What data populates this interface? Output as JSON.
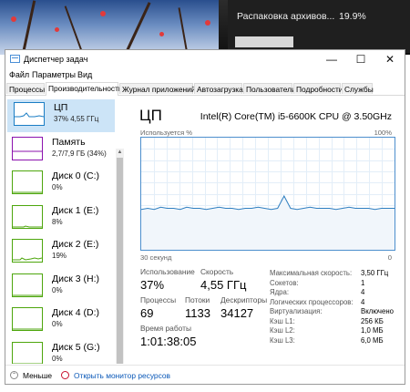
{
  "toast": {
    "title": "Распаковка архивов...",
    "percent": "19.9%"
  },
  "window": {
    "title": "Диспетчер задач",
    "controls": {
      "minimize": "—",
      "maximize": "☐",
      "close": "✕"
    }
  },
  "menu": [
    "Файл",
    "Параметры",
    "Вид"
  ],
  "tabs": [
    "Процессы",
    "Производительность",
    "Журнал приложений",
    "Автозагрузка",
    "Пользователи",
    "Подробности",
    "Службы"
  ],
  "sidebar": {
    "items": [
      {
        "name": "ЦП",
        "sub": "37% 4,55 ГГц",
        "color": "#1a7dc4"
      },
      {
        "name": "Память",
        "sub": "2,7/7,9 ГБ (34%)",
        "color": "#8b12ae"
      },
      {
        "name": "Диск 0 (C:)",
        "sub": "0%",
        "color": "#4da60c"
      },
      {
        "name": "Диск 1 (E:)",
        "sub": "8%",
        "color": "#4da60c"
      },
      {
        "name": "Диск 2 (E:)",
        "sub": "19%",
        "color": "#4da60c"
      },
      {
        "name": "Диск 3 (H:)",
        "sub": "0%",
        "color": "#4da60c"
      },
      {
        "name": "Диск 4 (D:)",
        "sub": "0%",
        "color": "#4da60c"
      },
      {
        "name": "Диск 5 (G:)",
        "sub": "0%",
        "color": "#4da60c"
      }
    ]
  },
  "cpu": {
    "title": "ЦП",
    "model": "Intel(R) Core(TM) i5-6600K CPU @ 3.50GHz",
    "util_label": "Используется %",
    "util_max": "100%",
    "graph_left": "30 секунд",
    "graph_right": "0",
    "history": [
      36,
      37,
      36,
      38,
      37,
      37,
      36,
      38,
      37,
      37,
      36,
      37,
      38,
      37,
      37,
      36,
      37,
      37,
      38,
      37,
      36,
      37,
      48,
      37,
      36,
      37,
      38,
      37,
      37,
      37,
      36,
      37,
      38,
      37,
      37,
      37,
      36,
      37,
      37,
      37
    ],
    "stats": {
      "usage_label": "Использование",
      "usage": "37%",
      "speed_label": "Скорость",
      "speed": "4,55 ГГц",
      "processes_label": "Процессы",
      "processes": "69",
      "threads_label": "Потоки",
      "threads": "1133",
      "handles_label": "Дескрипторы",
      "handles": "34127",
      "uptime_label": "Время работы",
      "uptime": "1:01:38:05"
    },
    "specs": [
      {
        "label": "Максимальная скорость:",
        "value": "3,50 ГГц"
      },
      {
        "label": "Сокетов:",
        "value": "1"
      },
      {
        "label": "Ядра:",
        "value": "4"
      },
      {
        "label": "Логических процессоров:",
        "value": "4"
      },
      {
        "label": "Виртуализация:",
        "value": "Включено"
      },
      {
        "label": "Кэш L1:",
        "value": "256 КБ"
      },
      {
        "label": "Кэш L2:",
        "value": "1,0 МБ"
      },
      {
        "label": "Кэш L3:",
        "value": "6,0 МБ"
      }
    ]
  },
  "footer": {
    "fewer": "Меньше",
    "monitor": "Открыть монитор ресурсов"
  }
}
